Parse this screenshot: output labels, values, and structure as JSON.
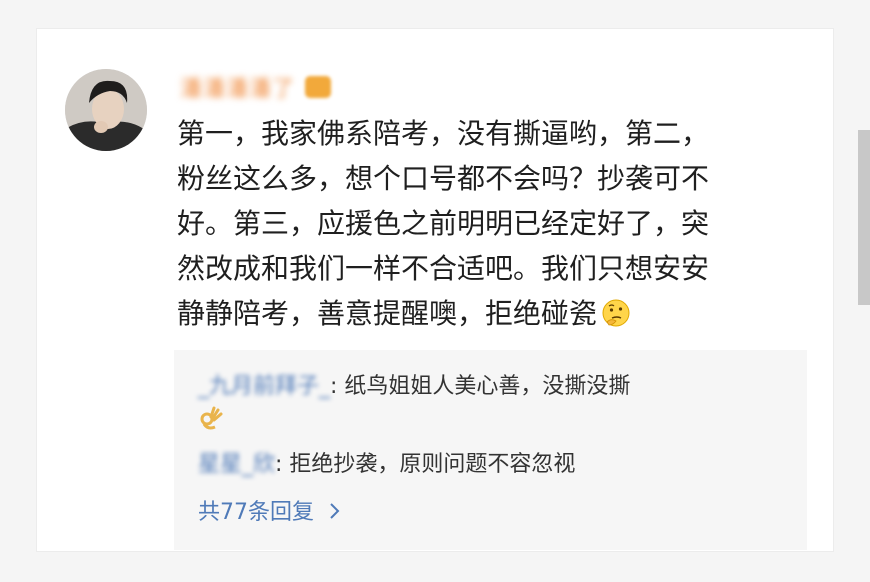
{
  "post": {
    "username": "潘潘潘潘了",
    "text_lines": [
      "第一，我家佛系陪考，没有撕逼哟，第二，",
      "粉丝这么多，想个口号都不会吗？抄袭可不",
      "好。第三，应援色之前明明已经定好了，突",
      "然改成和我们一样不合适吧。我们只想安安",
      "静静陪考，善意提醒噢，拒绝碰瓷"
    ],
    "trailing_emoji": "thinking-face-emoji"
  },
  "comments": {
    "items": [
      {
        "user": "_九月前拜子_",
        "text": "纸鸟姐姐人美心善，没撕没撕",
        "emoji": "ok-hand-emoji"
      },
      {
        "user": "星星_欣",
        "text": "拒绝抄袭，原则问题不容忽视"
      }
    ],
    "more_link": "共77条回复",
    "more_icon": "chevron-right-icon"
  },
  "colors": {
    "link_blue": "#4f7ab8",
    "username_orange": "#f08a3c",
    "comment_bg": "#f6f6f6"
  }
}
